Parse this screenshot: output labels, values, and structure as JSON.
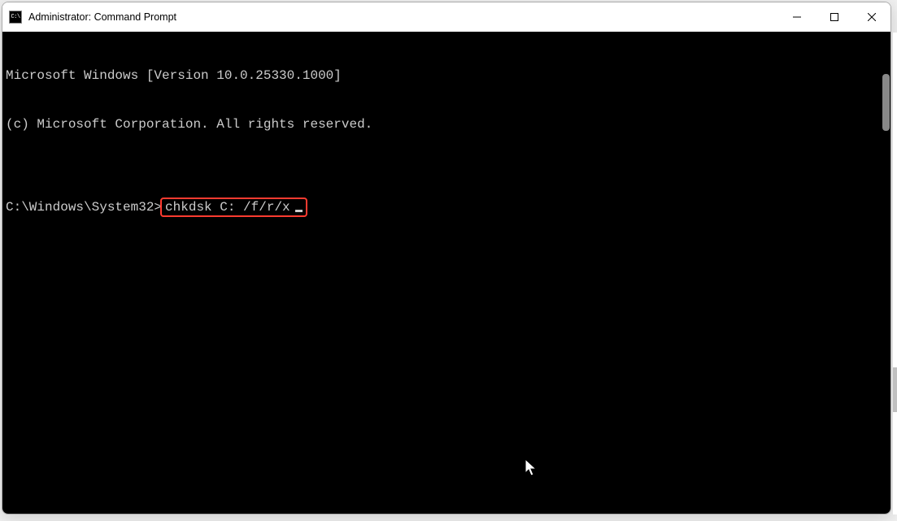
{
  "window": {
    "title": "Administrator: Command Prompt",
    "icon_label": "cmd-icon"
  },
  "terminal": {
    "line1": "Microsoft Windows [Version 10.0.25330.1000]",
    "line2": "(c) Microsoft Corporation. All rights reserved.",
    "blank": "",
    "prompt_path": "C:\\Windows\\System32>",
    "command": "chkdsk C: /f/r/x"
  },
  "controls": {
    "minimize": "Minimize",
    "maximize": "Maximize",
    "close": "Close"
  }
}
